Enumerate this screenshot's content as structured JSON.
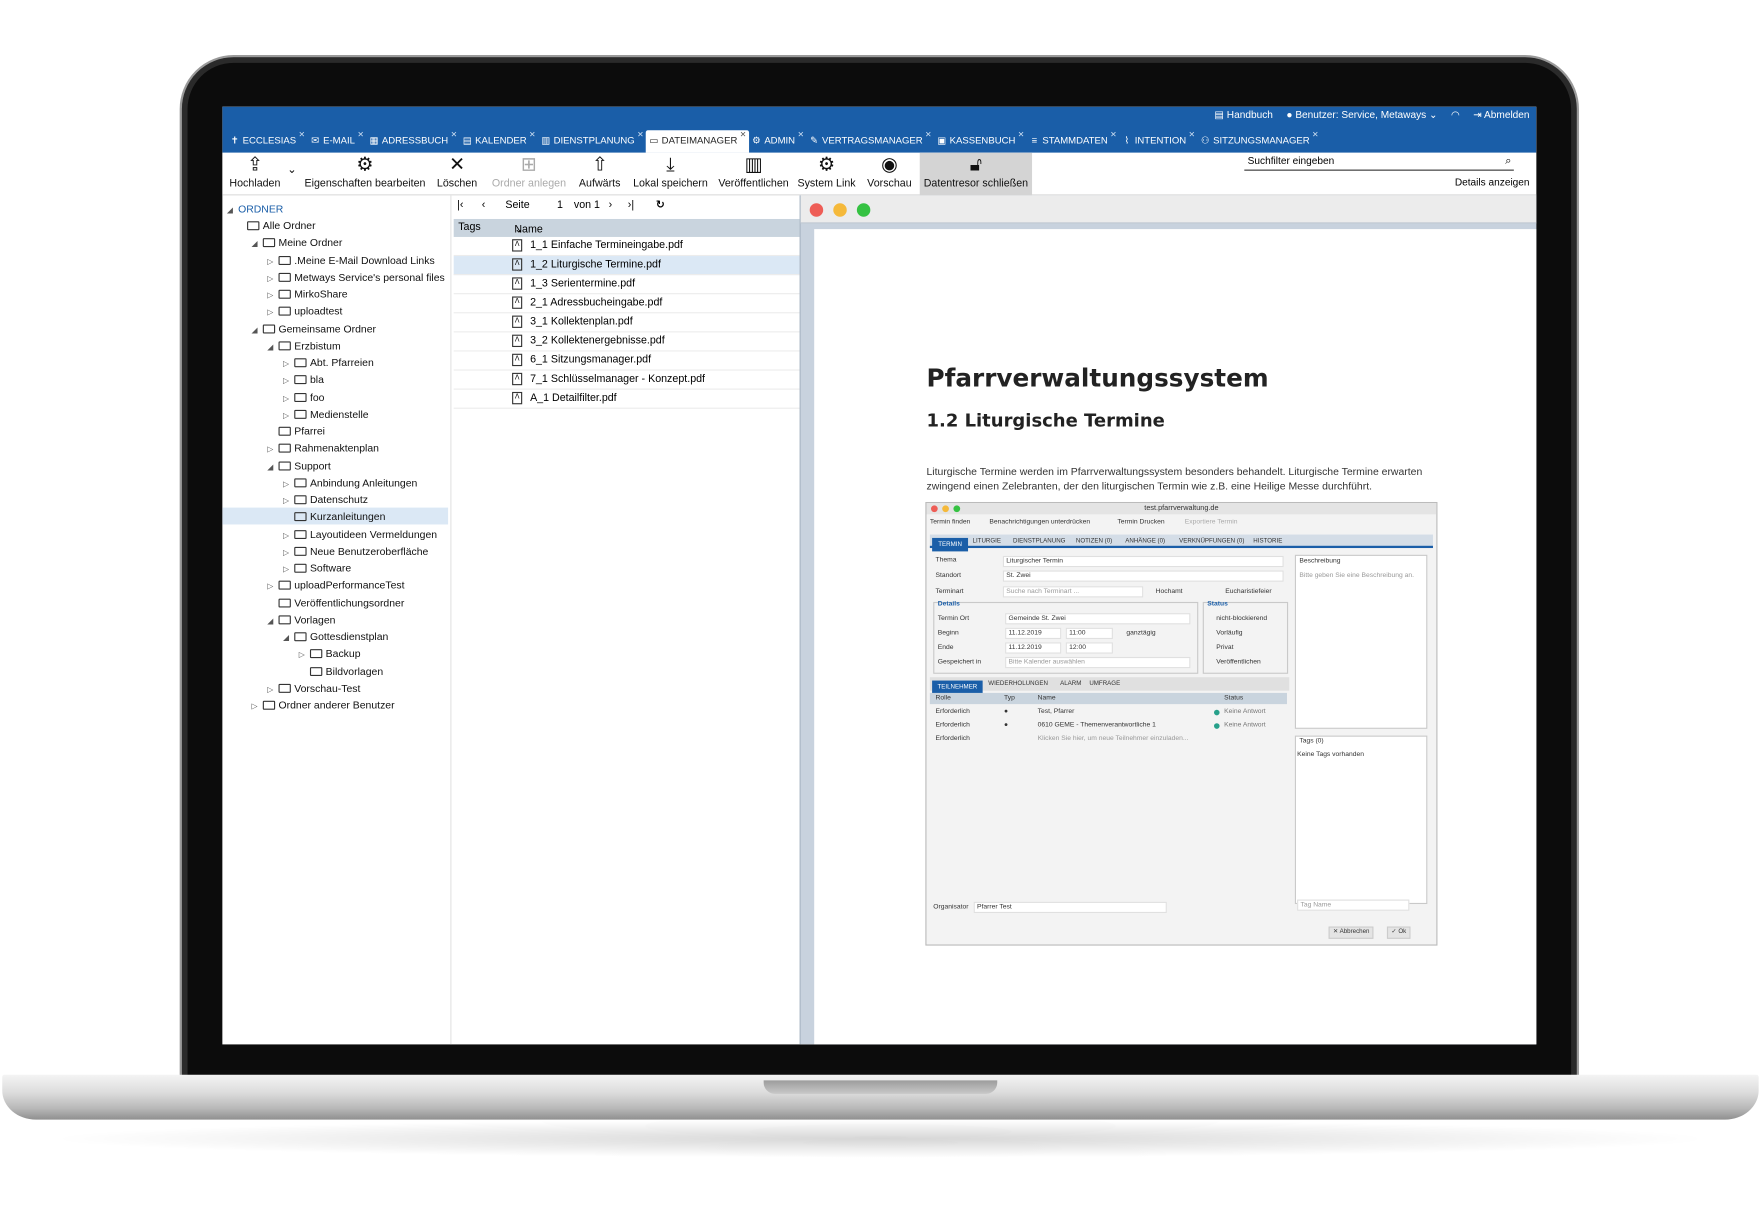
{
  "topbar": {
    "handbuch": "Handbuch",
    "user": "Benutzer: Service, Metaways",
    "abmelden": "Abmelden",
    "tabs": [
      {
        "label": "ECCLESIAS",
        "icon": "cross-icon"
      },
      {
        "label": "E-MAIL",
        "icon": "mail-icon"
      },
      {
        "label": "ADRESSBUCH",
        "icon": "addressbook-icon"
      },
      {
        "label": "KALENDER",
        "icon": "calendar-icon"
      },
      {
        "label": "DIENSTPLANUNG",
        "icon": "schedule-icon"
      },
      {
        "label": "DATEIMANAGER",
        "icon": "folder-icon"
      },
      {
        "label": "ADMIN",
        "icon": "gear-icon"
      },
      {
        "label": "VERTRAGSMANAGER",
        "icon": "contract-icon"
      },
      {
        "label": "KASSENBUCH",
        "icon": "cashbook-icon"
      },
      {
        "label": "STAMMDATEN",
        "icon": "database-icon"
      },
      {
        "label": "INTENTION",
        "icon": "candle-icon"
      },
      {
        "label": "SITZUNGSMANAGER",
        "icon": "meeting-icon"
      }
    ]
  },
  "toolbar": {
    "hochladen": "Hochladen",
    "eigenschaften": "Eigenschaften bearbeiten",
    "loeschen": "Löschen",
    "ordner_anlegen": "Ordner anlegen",
    "aufwaerts": "Aufwärts",
    "lokal_speichern": "Lokal speichern",
    "veroeffentlichen": "Veröffentlichen",
    "system_link": "System Link",
    "vorschau": "Vorschau",
    "datentresor": "Datentresor schließen",
    "search_placeholder": "Suchfilter eingeben",
    "details": "Details anzeigen"
  },
  "tree": {
    "root": "ORDNER",
    "items": [
      "Alle Ordner",
      "Meine Ordner",
      ".Meine E-Mail Download Links",
      "Metways Service's personal files",
      "MirkoShare",
      "uploadtest",
      "Gemeinsame Ordner",
      "Erzbistum",
      "Abt. Pfarreien",
      "bla",
      "foo",
      "Medienstelle",
      "Pfarrei",
      "Rahmenaktenplan",
      "Support",
      "Anbindung Anleitungen",
      "Datenschutz",
      "Kurzanleitungen",
      "Layoutideen Vermeldungen",
      "Neue Benutzeroberfläche",
      "Software",
      "uploadPerformanceTest",
      "Veröffentlichungsordner",
      "Vorlagen",
      "Gottesdienstplan",
      "Backup",
      "Bildvorlagen",
      "Vorschau-Test",
      "Ordner anderer Benutzer"
    ]
  },
  "files": {
    "page_label": "Seite",
    "page_num": "1",
    "page_of": "von 1",
    "col_tags": "Tags",
    "col_name": "Name",
    "items": [
      "1_1 Einfache Termineingabe.pdf",
      "1_2 Liturgische Termine.pdf",
      "1_3 Serientermine.pdf",
      "2_1 Adressbucheingabe.pdf",
      "3_1 Kollektenplan.pdf",
      "3_2 Kollektenergebnisse.pdf",
      "6_1 Sitzungsmanager.pdf",
      "7_1 Schlüsselmanager - Konzept.pdf",
      "A_1 Detailfilter.pdf"
    ]
  },
  "preview": {
    "title": "Pfarrverwaltungssystem",
    "subtitle": "1.2 Liturgische Termine",
    "text": "Liturgische Termine werden im Pfarrverwaltungssystem besonders behandelt. Liturgische Termine erwarten zwingend einen Zelebranten, der den liturgischen Termin wie z.B. eine Heilige Messe durchführt.",
    "shot": {
      "url": "test.pfarrverwaltung.de",
      "tool1": "Termin finden",
      "tool2": "Benachrichtigungen unterdrücken",
      "tool3": "Termin Drucken",
      "tool4": "Exportiere Termin",
      "tabs": [
        "TERMIN",
        "LITURGIE",
        "DIENSTPLANUNG",
        "NOTIZEN (0)",
        "ANHÄNGE (0)",
        "VERKNÜPFUNGEN (0)",
        "HISTORIE"
      ],
      "thema_l": "Thema",
      "thema_v": "Liturgischer Termin",
      "standort_l": "Standort",
      "standort_v": "St. Zwei",
      "terminart_l": "Terminart",
      "terminart_ph": "Suche nach Terminart ...",
      "hochamt": "Hochamt",
      "euchar": "Eucharistiefeier",
      "details_h": "Details",
      "status_h": "Status",
      "ort_l": "Termin Ort",
      "ort_v": "Gemeinde St. Zwei",
      "beginn_l": "Beginn",
      "beginn_d": "11.12.2019",
      "beginn_t": "11:00",
      "ganztaegig": "ganztägig",
      "ende_l": "Ende",
      "ende_d": "11.12.2019",
      "ende_t": "12:00",
      "gesp_l": "Gespeichert in",
      "gesp_ph": "Bitte Kalender auswählen",
      "st1": "nicht-blockierend",
      "st2": "Vorläufig",
      "st3": "Privat",
      "st4": "Veröffentlichen",
      "besch_h": "Beschreibung",
      "besch_ph": "Bitte geben Sie eine Beschreibung an.",
      "subtabs": [
        "TEILNEHMER",
        "WIEDERHOLUNGEN",
        "ALARM",
        "UMFRAGE"
      ],
      "g_rolle": "Rolle",
      "g_typ": "Typ",
      "g_name": "Name",
      "g_status": "Status",
      "rows": [
        {
          "rolle": "Erforderlich",
          "name": "Test, Pfarrer",
          "status": "Keine Antwort"
        },
        {
          "rolle": "Erforderlich",
          "name": "0610 GEME - Themenverantwortliche 1",
          "status": "Keine Antwort"
        },
        {
          "rolle": "Erforderlich",
          "name": "Klicken Sie hier, um neue Teilnehmer einzuladen...",
          "status": ""
        }
      ],
      "tags_h": "Tags (0)",
      "tags_v": "Keine Tags vorhanden",
      "tag_ph": "Tag Name",
      "org_l": "Organisator",
      "org_v": "Pfarrer Test",
      "abbrechen": "Abbrechen",
      "ok": "Ok"
    }
  }
}
